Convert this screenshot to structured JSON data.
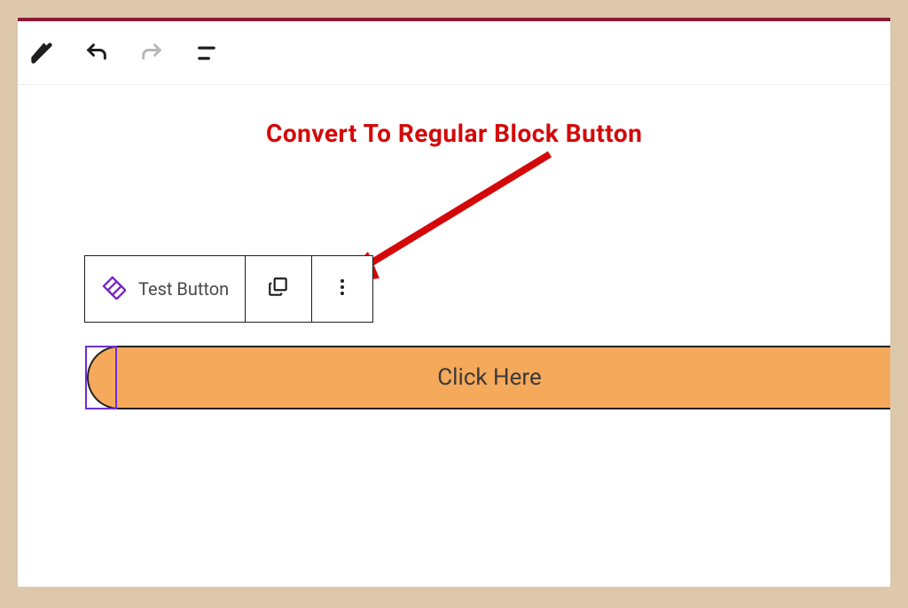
{
  "annotation": {
    "title": "Convert To Regular Block Button"
  },
  "blockToolbar": {
    "label": "Test Button"
  },
  "button": {
    "text": "Click Here"
  },
  "colors": {
    "accent": "#d40808",
    "buttonBg": "#f5a95b",
    "reusableIcon": "#7a24c7"
  }
}
